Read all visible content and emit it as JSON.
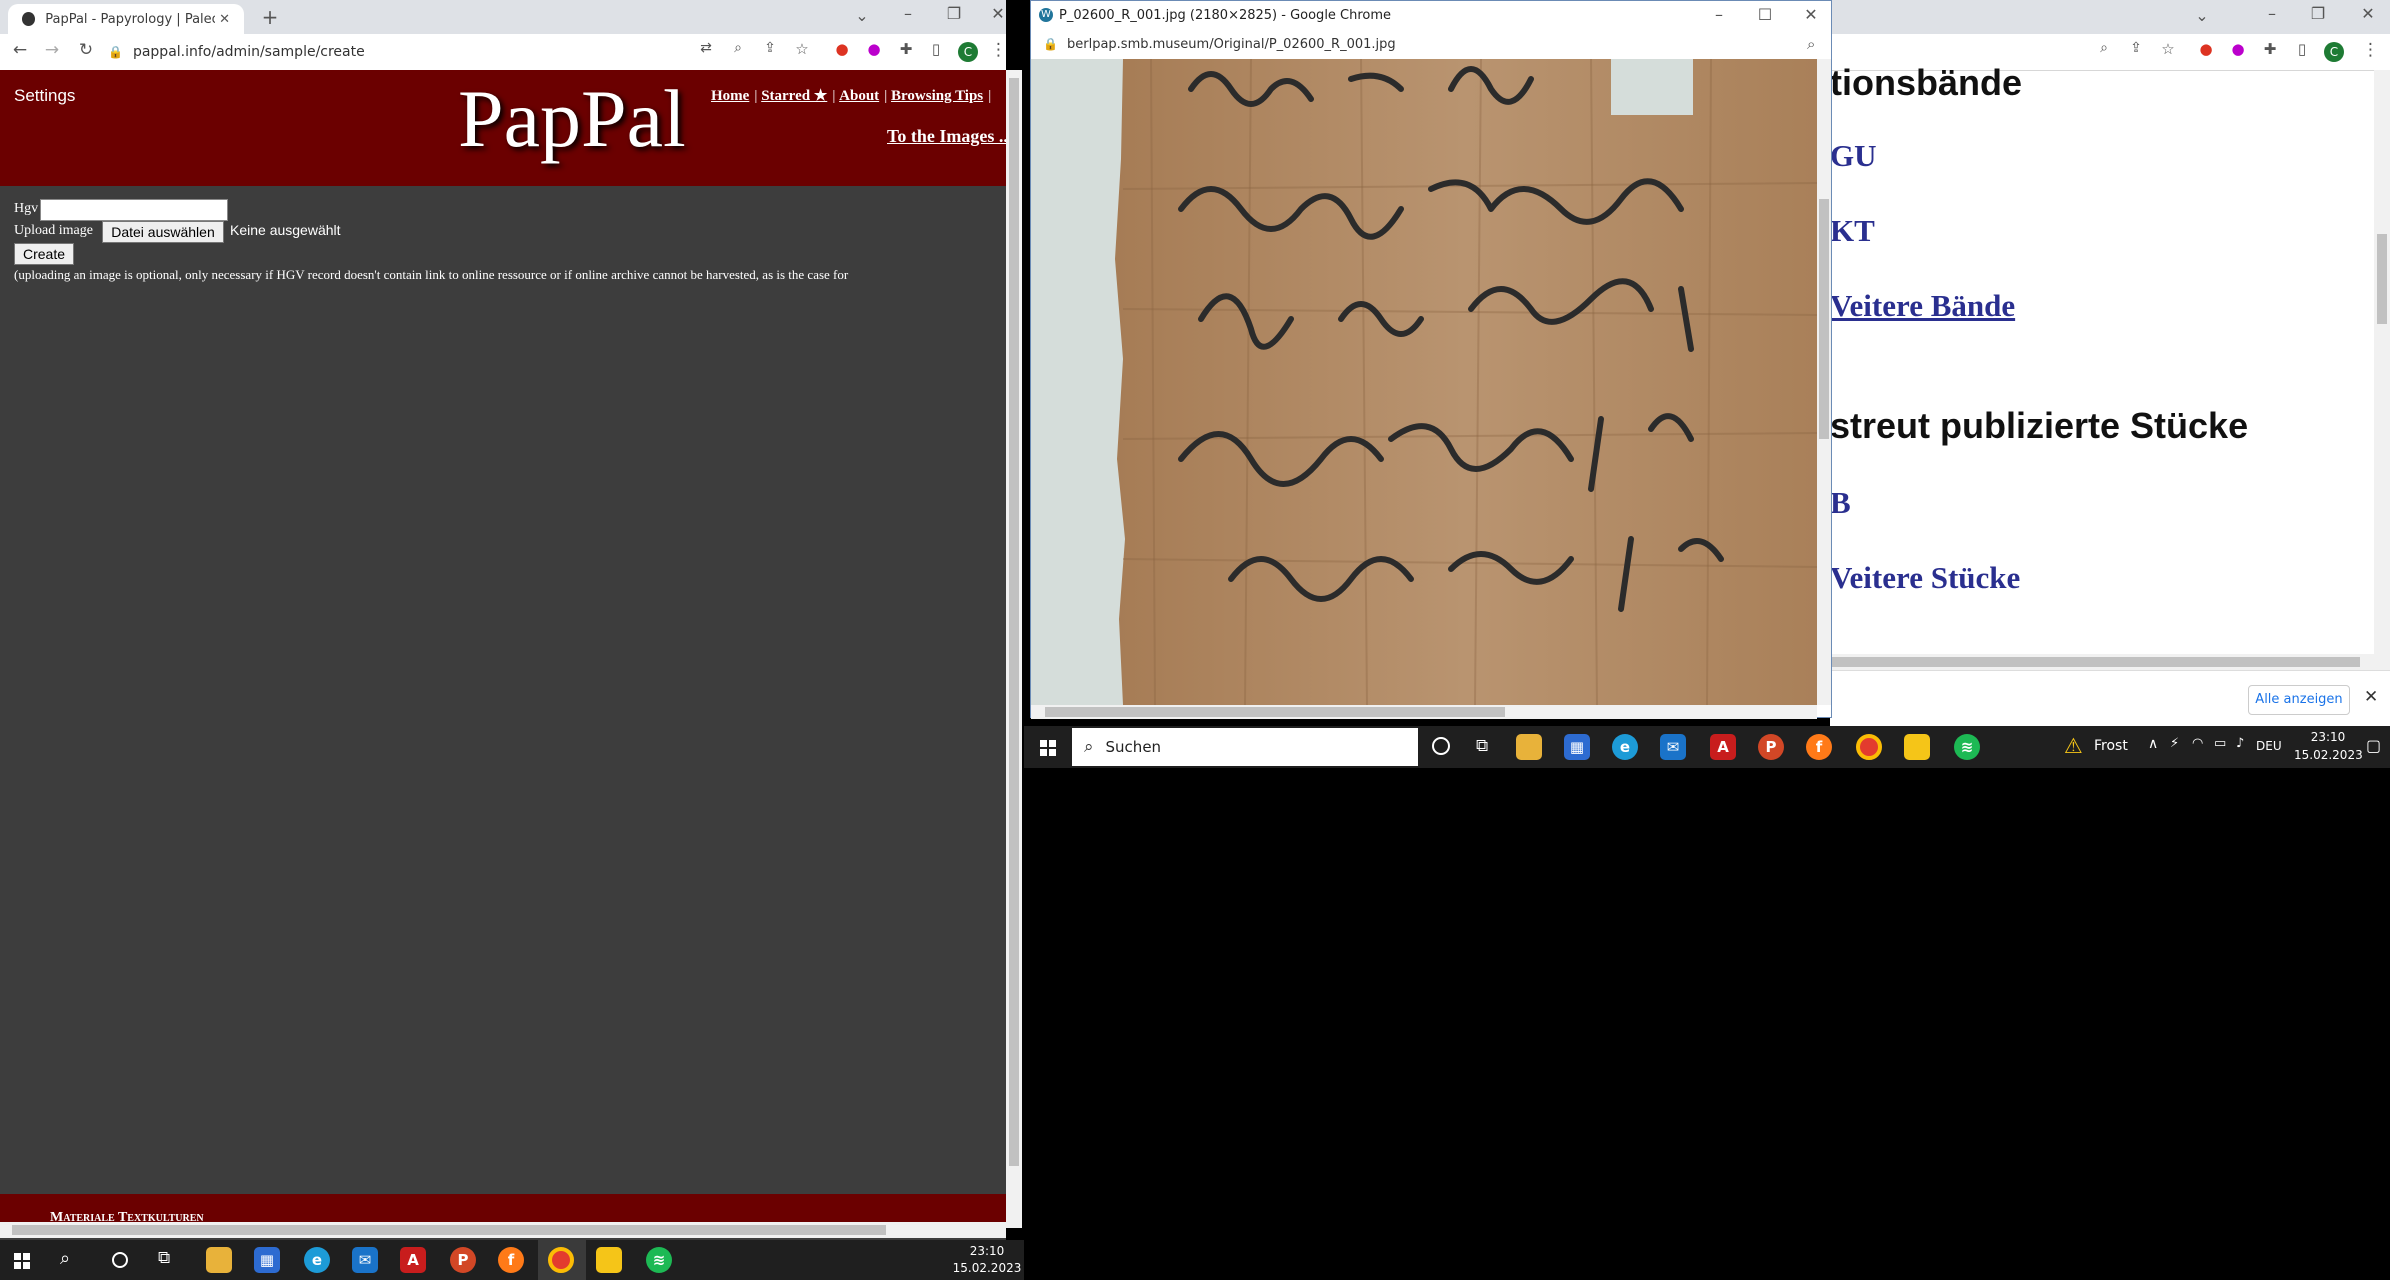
{
  "left_window": {
    "tab_title": "PapPal - Papyrology | Paleograph",
    "new_tab": "+",
    "url": "pappal.info/admin/sample/create",
    "avatar_letter": "C",
    "site": {
      "settings": "Settings",
      "logo": "PapPal",
      "nav": [
        "Home",
        "Starred ★",
        "About",
        "Browsing Tips"
      ],
      "to_images": "To the Images ...",
      "hgv_label": "Hgv",
      "upload_label": "Upload image",
      "file_button": "Datei auswählen",
      "file_status": "Keine ausgewählt",
      "create_button": "Create",
      "note": "(uploading an image is optional, only necessary if HGV record doesn't contain link to online ressource or if online archive cannot be harvested, as is the case for",
      "footer_text": "Materiale Textkulturen"
    }
  },
  "popup_window": {
    "title": "P_02600_R_001.jpg (2180×2825) - Google Chrome",
    "url": "berlpap.smb.museum/Original/P_02600_R_001.jpg",
    "image_alt": "papyrus-fragment"
  },
  "right_window": {
    "avatar_letter": "C",
    "headings": [
      "tionsbände",
      "streut publizierte Stücke"
    ],
    "links": [
      "GU",
      "KT",
      "Veitere Bände",
      "B",
      "Veitere Stücke"
    ],
    "show_all": "Alle anzeigen"
  },
  "taskbar_bottom": {
    "time": "23:10",
    "date": "15.02.2023"
  },
  "taskbar_mid": {
    "search": "Suchen",
    "weather": "Frost",
    "lang": "DEU",
    "time": "23:10",
    "date": "15.02.2023"
  },
  "colors": {
    "header_red": "#6b0000",
    "body_gray": "#3d3d3d",
    "link_blue": "#2a2f8f",
    "papyrus": "#b38e68"
  }
}
